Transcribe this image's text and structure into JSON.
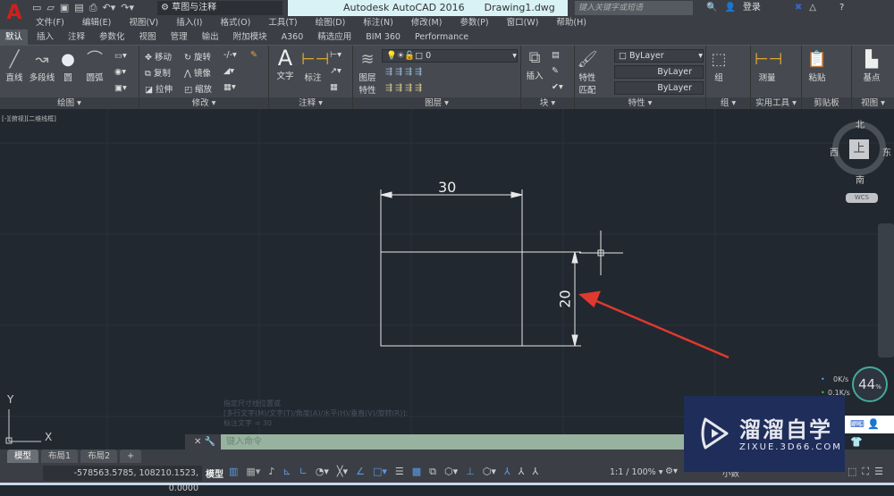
{
  "titlebar": {
    "app_title": "Autodesk AutoCAD 2016",
    "file_name": "Drawing1.dwg",
    "workspace": "草图与注释",
    "search_placeholder": "键入关键字或短语",
    "login": "登录"
  },
  "menu": [
    "文件(F)",
    "编辑(E)",
    "视图(V)",
    "插入(I)",
    "格式(O)",
    "工具(T)",
    "绘图(D)",
    "标注(N)",
    "修改(M)",
    "参数(P)",
    "窗口(W)",
    "帮助(H)"
  ],
  "ribbon_tabs": [
    "默认",
    "插入",
    "注释",
    "参数化",
    "视图",
    "管理",
    "输出",
    "附加模块",
    "A360",
    "精选应用",
    "BIM 360",
    "Performance"
  ],
  "ribbon": {
    "draw": {
      "label": "绘图",
      "tools": [
        "直线",
        "多段线",
        "圆",
        "圆弧"
      ]
    },
    "modify": {
      "label": "修改",
      "tools": [
        "移动",
        "旋转",
        "复制",
        "镜像",
        "拉伸",
        "缩放"
      ]
    },
    "annotation": {
      "label": "注释",
      "tools": [
        "文字",
        "标注"
      ]
    },
    "layers": {
      "label": "图层",
      "tools": [
        "图层特性"
      ],
      "current_layer": "0"
    },
    "block": {
      "label": "块",
      "tools": [
        "插入"
      ]
    },
    "properties": {
      "label": "特性",
      "tools": [
        "特性匹配"
      ],
      "color": "ByLayer",
      "linetype": "ByLayer",
      "lineweight": "ByLayer"
    },
    "groups": {
      "label": "组",
      "tools": [
        "组"
      ]
    },
    "utilities": {
      "label": "实用工具",
      "tools": [
        "测量"
      ]
    },
    "clipboard": {
      "label": "剪贴板",
      "tools": [
        "粘贴"
      ]
    },
    "view": {
      "label": "视图",
      "tools": [
        "基点"
      ]
    }
  },
  "viewport": {
    "label": "[-][俯视][二维线框]",
    "viewcube": {
      "face": "上",
      "north": "北",
      "south": "南",
      "east": "东",
      "west": "西",
      "ucs": "WCS"
    }
  },
  "drawing": {
    "dim_horizontal": "30",
    "dim_vertical": "20",
    "arrow_color": "#e0392f"
  },
  "ucs": {
    "x": "X",
    "y": "Y"
  },
  "command": {
    "history": [
      "指定尺寸线位置或",
      "[多行文字(M)/文字(T)/角度(A)/水平(H)/垂直(V)/旋转(R)]:",
      "标注文字 = 30"
    ],
    "placeholder": "键入命令"
  },
  "layout_tabs": [
    "模型",
    "布局1",
    "布局2",
    "+"
  ],
  "status": {
    "coords": "-578563.5785, 108210.1523, 0.0000",
    "model": "模型",
    "scale": "1:1 / 100%",
    "units": "小数"
  },
  "overlay": {
    "upload": "0K/s",
    "download": "0.1K/s",
    "cpu_percent": "44",
    "cpu_unit": "%"
  },
  "watermark": {
    "name": "溜溜自学",
    "url": "ZIXUE.3D66.COM"
  }
}
